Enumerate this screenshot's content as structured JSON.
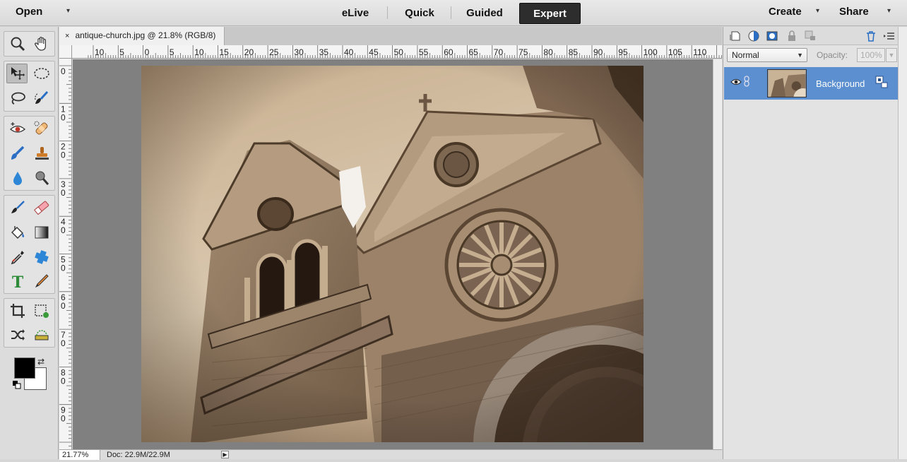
{
  "topbar": {
    "open_label": "Open",
    "modes": [
      {
        "label": "eLive",
        "active": false
      },
      {
        "label": "Quick",
        "active": false
      },
      {
        "label": "Guided",
        "active": false
      },
      {
        "label": "Expert",
        "active": true
      }
    ],
    "create_label": "Create",
    "share_label": "Share"
  },
  "toolbox": {
    "tools": [
      "zoom-icon",
      "hand-icon",
      "move-icon",
      "marquee-icon",
      "lasso-icon",
      "quick-selection-icon",
      "red-eye-icon",
      "spot-healing-icon",
      "smart-brush-icon",
      "clone-stamp-icon",
      "blur-icon",
      "sponge-icon",
      "brush-icon",
      "eraser-icon",
      "paint-bucket-icon",
      "gradient-icon",
      "eyedropper-icon",
      "custom-shape-icon",
      "type-icon",
      "pencil-icon",
      "crop-icon",
      "recompose-icon",
      "content-aware-move-icon",
      "straighten-icon"
    ],
    "selected_tool": "move-icon",
    "foreground_color": "#000000",
    "background_color": "#ffffff"
  },
  "document": {
    "tab_title": "antique-church.jpg @ 21.8% (RGB/8)",
    "close_glyph": "×",
    "ruler_top_labels": [
      "10",
      "5",
      "0",
      "5",
      "10",
      "15",
      "20",
      "25",
      "30",
      "35",
      "40",
      "45",
      "50",
      "55",
      "60",
      "65",
      "70",
      "75",
      "80",
      "85",
      "90",
      "95",
      "100",
      "105",
      "110"
    ],
    "ruler_left_labels": [
      "0",
      "10",
      "20",
      "30",
      "40",
      "50",
      "60",
      "70",
      "80",
      "90"
    ]
  },
  "status": {
    "zoom": "21.77%",
    "doc_info": "Doc: 22.9M/22.9M",
    "arrow_glyph": "▶"
  },
  "layers": {
    "blend_mode": "Normal",
    "opacity_label": "Opacity:",
    "opacity_value": "100%",
    "items": [
      {
        "name": "Background",
        "visible": true,
        "selected": true
      }
    ]
  },
  "colors": {
    "accent_selected_layer": "#5b8fd0",
    "active_mode_bg": "#2d2d2d"
  }
}
